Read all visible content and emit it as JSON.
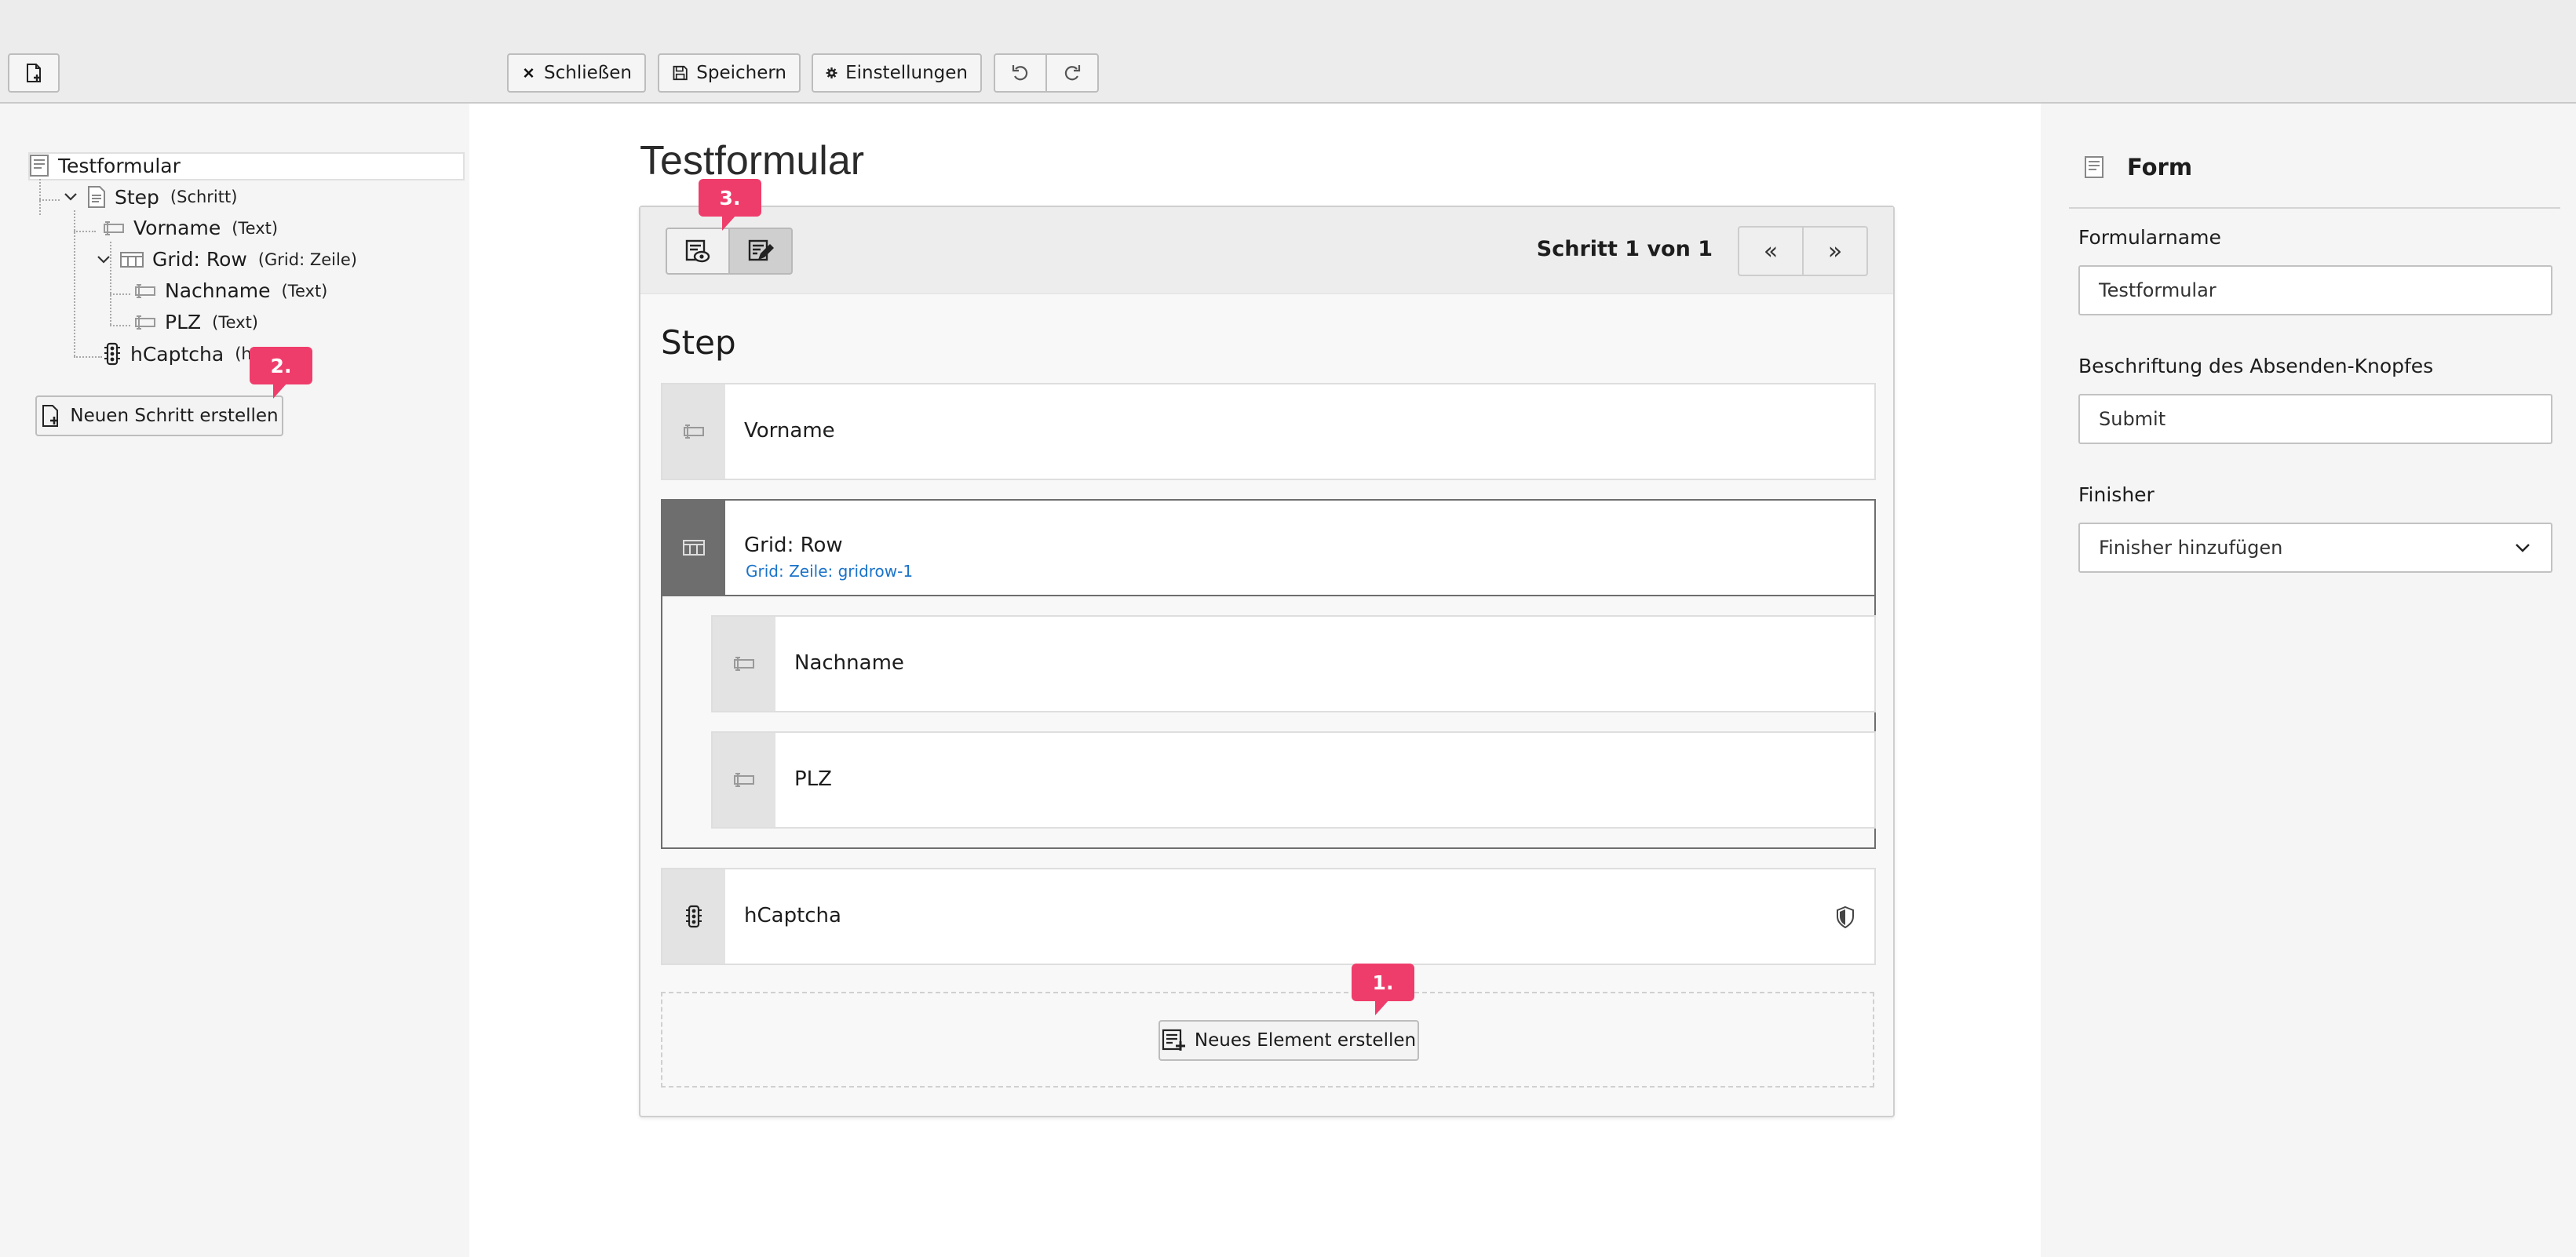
{
  "toolbar": {
    "close_label": "Schließen",
    "save_label": "Speichern",
    "settings_label": "Einstellungen"
  },
  "tree": {
    "root": "Testformular",
    "step": {
      "name": "Step",
      "type": "(Schritt)"
    },
    "vorname": {
      "name": "Vorname",
      "type": "(Text)"
    },
    "grid": {
      "name": "Grid: Row",
      "type": "(Grid: Zeile)"
    },
    "nachname": {
      "name": "Nachname",
      "type": "(Text)"
    },
    "plz": {
      "name": "PLZ",
      "type": "(Text)"
    },
    "hcaptcha": {
      "name": "hCaptcha",
      "type": "(h"
    },
    "new_step_label": "Neuen Schritt erstellen"
  },
  "badges": {
    "one": "1.",
    "two": "2.",
    "three": "3."
  },
  "stage": {
    "form_title": "Testformular",
    "step_indicator": "Schritt 1 von 1",
    "prev_icon": "«",
    "next_icon": "»",
    "step_title": "Step",
    "elements": {
      "vorname": "Vorname",
      "grid_label": "Grid: Row",
      "grid_sub": "Grid: Zeile: gridrow-1",
      "nachname": "Nachname",
      "plz": "PLZ",
      "hcaptcha": "hCaptcha"
    },
    "new_element_label": "Neues Element erstellen"
  },
  "inspector": {
    "title": "Form",
    "formname_label": "Formularname",
    "formname_value": "Testformular",
    "submit_label": "Beschriftung des Absenden-Knopfes",
    "submit_value": "Submit",
    "finisher_label": "Finisher",
    "finisher_value": "Finisher hinzufügen"
  },
  "colors": {
    "badge": "#ef3d6b",
    "link": "#1a73c9",
    "grid_handle": "#6e6e6e"
  }
}
